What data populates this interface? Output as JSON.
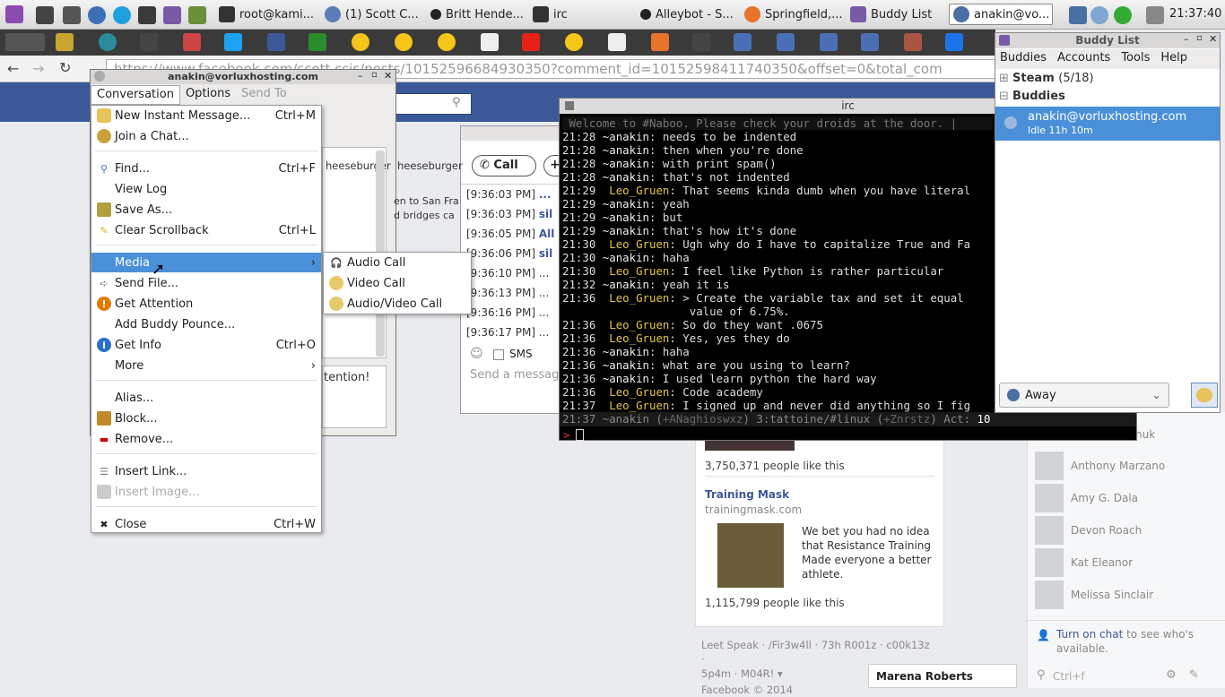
{
  "panel": {
    "tasks": [
      "root@kami...",
      "(1) Scott C...",
      "Britt Hende...",
      "irc",
      "Alleybot - S...",
      "Springfield,...",
      "Buddy List",
      "anakin@vo..."
    ],
    "clock": "21:37:40"
  },
  "browser": {
    "url": "https://www.facebook.com/scott.csis/posts/10152596684930350?comment_id=10152598411740350&offset=0&total_com"
  },
  "conv": {
    "title": "anakin@vorluxhosting.com",
    "menubar": [
      "Conversation",
      "Options",
      "Send To"
    ],
    "partial_text": [
      "heeseburger",
      "en to San Fra",
      "d bridges ca",
      "tention!"
    ]
  },
  "menu": {
    "items": [
      {
        "label": "New Instant Message...",
        "shortcut": "Ctrl+M"
      },
      {
        "label": "Join a Chat...",
        "shortcut": ""
      },
      {
        "label": "Find...",
        "shortcut": "Ctrl+F"
      },
      {
        "label": "View Log",
        "shortcut": ""
      },
      {
        "label": "Save As...",
        "shortcut": ""
      },
      {
        "label": "Clear Scrollback",
        "shortcut": "Ctrl+L"
      },
      {
        "label": "Media",
        "shortcut": ""
      },
      {
        "label": "Send File...",
        "shortcut": ""
      },
      {
        "label": "Get Attention",
        "shortcut": ""
      },
      {
        "label": "Add Buddy Pounce...",
        "shortcut": ""
      },
      {
        "label": "Get Info",
        "shortcut": "Ctrl+O"
      },
      {
        "label": "More",
        "shortcut": ""
      },
      {
        "label": "Alias...",
        "shortcut": ""
      },
      {
        "label": "Block...",
        "shortcut": ""
      },
      {
        "label": "Remove...",
        "shortcut": ""
      },
      {
        "label": "Insert Link...",
        "shortcut": ""
      },
      {
        "label": "Insert Image...",
        "shortcut": ""
      },
      {
        "label": "Close",
        "shortcut": "Ctrl+W"
      }
    ],
    "submenu": [
      "Audio Call",
      "Video Call",
      "Audio/Video Call"
    ]
  },
  "conv2": {
    "call_label": "Call",
    "rows": [
      {
        "time": "[9:36:03 PM]",
        "text": "..."
      },
      {
        "time": "[9:36:03 PM]",
        "text": "sil"
      },
      {
        "time": "[9:36:05 PM]",
        "text": "All"
      },
      {
        "time": "[9:36:06 PM]",
        "text": "sil"
      },
      {
        "time": "[9:36:10 PM]",
        "text": "..."
      },
      {
        "time": "[9:36:13 PM]",
        "text": "..."
      },
      {
        "time": "[9:36:16 PM]",
        "text": "..."
      },
      {
        "time": "[9:36:17 PM]",
        "text": "..."
      }
    ],
    "sms_label": "SMS",
    "input_placeholder": "Send a messag"
  },
  "irc": {
    "title": "irc",
    "topic": " Welcome to #Naboo. Please check your droids at the door. |",
    "lines": [
      {
        "t": "21:28",
        "n": "~anakin",
        "m": ": needs to be indented",
        "me": true
      },
      {
        "t": "21:28",
        "n": "~anakin",
        "m": ": then when you're done",
        "me": true
      },
      {
        "t": "21:28",
        "n": "~anakin",
        "m": ": with print spam()",
        "me": true
      },
      {
        "t": "21:28",
        "n": "~anakin",
        "m": ": that's not indented",
        "me": true
      },
      {
        "t": "21:29",
        "n": " Leo_Gruen",
        "m": ": That seems kinda dumb when you have literal",
        "me": false
      },
      {
        "t": "21:29",
        "n": "~anakin",
        "m": ": yeah",
        "me": true
      },
      {
        "t": "21:29",
        "n": "~anakin",
        "m": ": but",
        "me": true
      },
      {
        "t": "21:29",
        "n": "~anakin",
        "m": ": that's how it's done",
        "me": true
      },
      {
        "t": "21:30",
        "n": " Leo_Gruen",
        "m": ": Ugh why do I have to capitalize True and Fa",
        "me": false
      },
      {
        "t": "21:30",
        "n": "~anakin",
        "m": ": haha",
        "me": true
      },
      {
        "t": "21:30",
        "n": " Leo_Gruen",
        "m": ": I feel like Python is rather particular",
        "me": false
      },
      {
        "t": "21:32",
        "n": "~anakin",
        "m": ": yeah it is",
        "me": true
      },
      {
        "t": "21:36",
        "n": " Leo_Gruen",
        "m": ": > Create the variable tax and set it equal",
        "me": false
      },
      {
        "t": "",
        "n": "",
        "m": "                   value of 6.75%.",
        "me": false
      },
      {
        "t": "21:36",
        "n": " Leo_Gruen",
        "m": ": So do they want .0675",
        "me": false
      },
      {
        "t": "21:36",
        "n": " Leo_Gruen",
        "m": ": Yes, yes they do",
        "me": false
      },
      {
        "t": "21:36",
        "n": "~anakin",
        "m": ": haha",
        "me": true
      },
      {
        "t": "21:36",
        "n": "~anakin",
        "m": ": what are you using to learn?",
        "me": true
      },
      {
        "t": "21:36",
        "n": "~anakin",
        "m": ": I used learn python the hard way",
        "me": true
      },
      {
        "t": "21:36",
        "n": " Leo_Gruen",
        "m": ": Code academy",
        "me": false
      },
      {
        "t": "21:37",
        "n": " Leo_Gruen",
        "m": ": I signed up and never did anything so I fig",
        "me": false
      }
    ],
    "statusline_parts": [
      "21:37 ~anakin (",
      "+ANaghioswxz",
      ") 3:tattoine/#linux (",
      "+Znrstz",
      ") Act: ",
      "10"
    ]
  },
  "buddylist": {
    "title": "Buddy List",
    "menu": [
      "Buddies",
      "Accounts",
      "Tools",
      "Help"
    ],
    "groups": [
      {
        "name": "Steam",
        "count": "(5/18)"
      },
      {
        "name": "Buddies",
        "count": ""
      }
    ],
    "buddy": {
      "name": "anakin@vorluxhosting.com",
      "status": "Idle 11h 10m"
    },
    "status": "Away"
  },
  "fb": {
    "likes1": "3,750,371 people like this",
    "ad_title": "Training Mask",
    "ad_domain": "trainingmask.com",
    "ad_text": "We bet you had no idea that Resistance Training Made everyone a better athlete.",
    "likes2": "1,115,799 people like this",
    "footer1": "Leet Speak · /Fir3w4ll · 73h R001z · c00k13z ·",
    "footer2": "5p4m · M04R! ▾",
    "copyright": "Facebook © 2014",
    "chat_name": "Marena Roberts",
    "partial": "huk",
    "friends": [
      "Anthony Marzano",
      "Amy G. Dala",
      "Devon Roach",
      "Kat Eleanor",
      "Melissa Sinclair"
    ],
    "chat_on_link": "Turn on chat",
    "chat_on_text": " to see who's available.",
    "search_placeholder": "Ctrl+f"
  }
}
